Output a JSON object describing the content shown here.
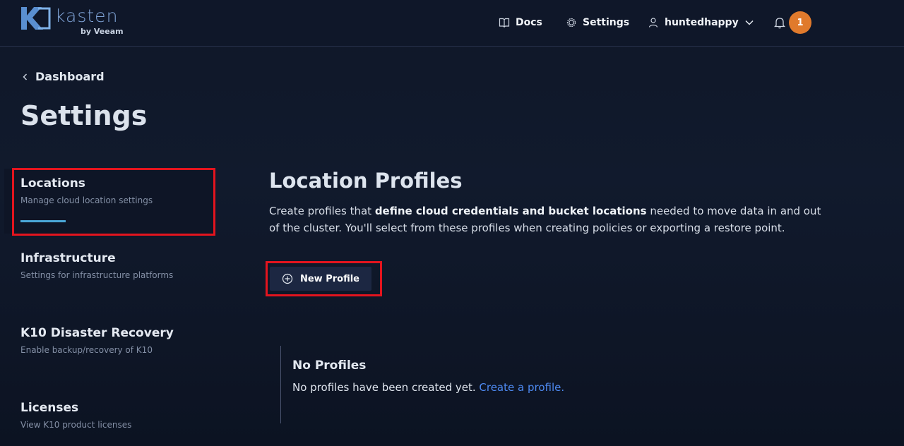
{
  "brand": {
    "name": "kasten",
    "sub": "by Veeam"
  },
  "nav": {
    "docs": "Docs",
    "settings": "Settings",
    "user": "huntedhappy",
    "notifications": "1"
  },
  "breadcrumb": {
    "label": "Dashboard"
  },
  "page_title": "Settings",
  "sidebar": {
    "items": [
      {
        "title": "Locations",
        "desc": "Manage cloud location settings"
      },
      {
        "title": "Infrastructure",
        "desc": "Settings for infrastructure platforms"
      },
      {
        "title": "K10 Disaster Recovery",
        "desc": "Enable backup/recovery of K10"
      },
      {
        "title": "Licenses",
        "desc": "View K10 product licenses"
      }
    ]
  },
  "main": {
    "title": "Location Profiles",
    "desc_pre": "Create profiles that ",
    "desc_bold": "define cloud credentials and bucket locations",
    "desc_post": " needed to move data in and out of the cluster. You'll select from these profiles when creating policies or exporting a restore point.",
    "new_button": "New Profile",
    "empty_title": "No Profiles",
    "empty_text": "No profiles have been created yet. ",
    "empty_link": "Create a profile."
  },
  "colors": {
    "accent": "#4aa8d8",
    "highlight": "#e3141e",
    "badge": "#e07a2c",
    "link": "#4e8af2"
  }
}
